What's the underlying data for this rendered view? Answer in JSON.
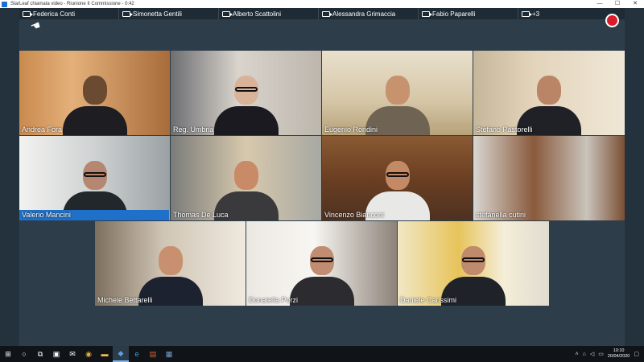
{
  "window": {
    "title": "StarLeaf chiamata video - Riunione II Commissione - 0:42",
    "minimize": "—",
    "maximize": "☐",
    "close": "✕"
  },
  "participants_strip": [
    "Federica Conti",
    "Simonetta Gentili",
    "Alberto Scattolini",
    "Alessandra Grimaccia",
    "Fabio Paparelli",
    "+3"
  ],
  "tiles": [
    {
      "name": "Andrea Fora",
      "active": false
    },
    {
      "name": "Reg. Umbria",
      "active": false
    },
    {
      "name": "Eugenio Rondini",
      "active": false
    },
    {
      "name": "Stefano Pastorelli",
      "active": false
    },
    {
      "name": "Valerio Mancini",
      "active": true
    },
    {
      "name": "Thomas De Luca",
      "active": false
    },
    {
      "name": "Vincenzo Bianconi",
      "active": false
    },
    {
      "name": "stefanella cutini",
      "active": false
    },
    {
      "name": "Michele Bettarelli",
      "active": false
    },
    {
      "name": "Donatella Porzi",
      "active": false
    },
    {
      "name": "Daniele Carissimi",
      "active": false
    }
  ],
  "colors": {
    "hangup": "#d81e2c",
    "active_speaker": "#1e70c8",
    "background": "#2d3d49"
  },
  "taskbar": {
    "start_icon": "windows-start-icon",
    "clock_time": "10:10",
    "clock_date": "20/04/2020"
  }
}
